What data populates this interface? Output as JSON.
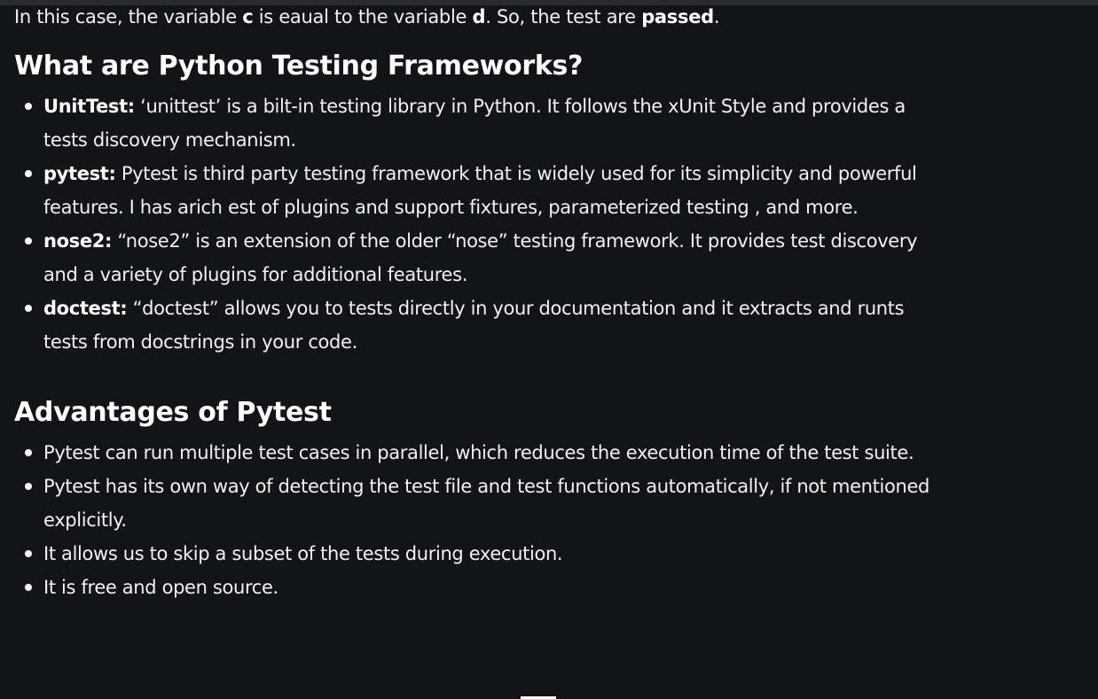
{
  "intro": {
    "part1": "In this case, the variable ",
    "var_c": "c",
    "part2": " is eaual to the variable ",
    "var_d": "d",
    "part3": ". So, the test are ",
    "passed": "passed",
    "part4": "."
  },
  "frameworks": {
    "heading": "What are Python Testing Frameworks?",
    "items": [
      {
        "term": "UnitTest:",
        "text": " ‘unittest’ is a bilt-in testing library in Python. It follows the xUnit Style and provides a tests discovery mechanism."
      },
      {
        "term": "pytest:",
        "text": " Pytest is third party testing framework that is widely used for its simplicity and powerful features. I has arich est of plugins and support fixtures, parameterized testing , and more."
      },
      {
        "term": "nose2:",
        "text": " “nose2” is an extension of the older “nose” testing framework. It provides test discovery and a variety of plugins for additional features."
      },
      {
        "term": "doctest:",
        "text": " “doctest” allows you to tests directly in your documentation and it extracts and runts tests from docstrings in your code."
      }
    ]
  },
  "advantages": {
    "heading": "Advantages of Pytest",
    "items": [
      "Pytest can run multiple test cases in parallel, which reduces the execution time of the test suite.",
      "Pytest has its own way of detecting the test file and test functions automatically, if not mentioned explicitly.",
      "It allows us to skip a subset of the tests during execution.",
      "It is free and open source."
    ]
  }
}
